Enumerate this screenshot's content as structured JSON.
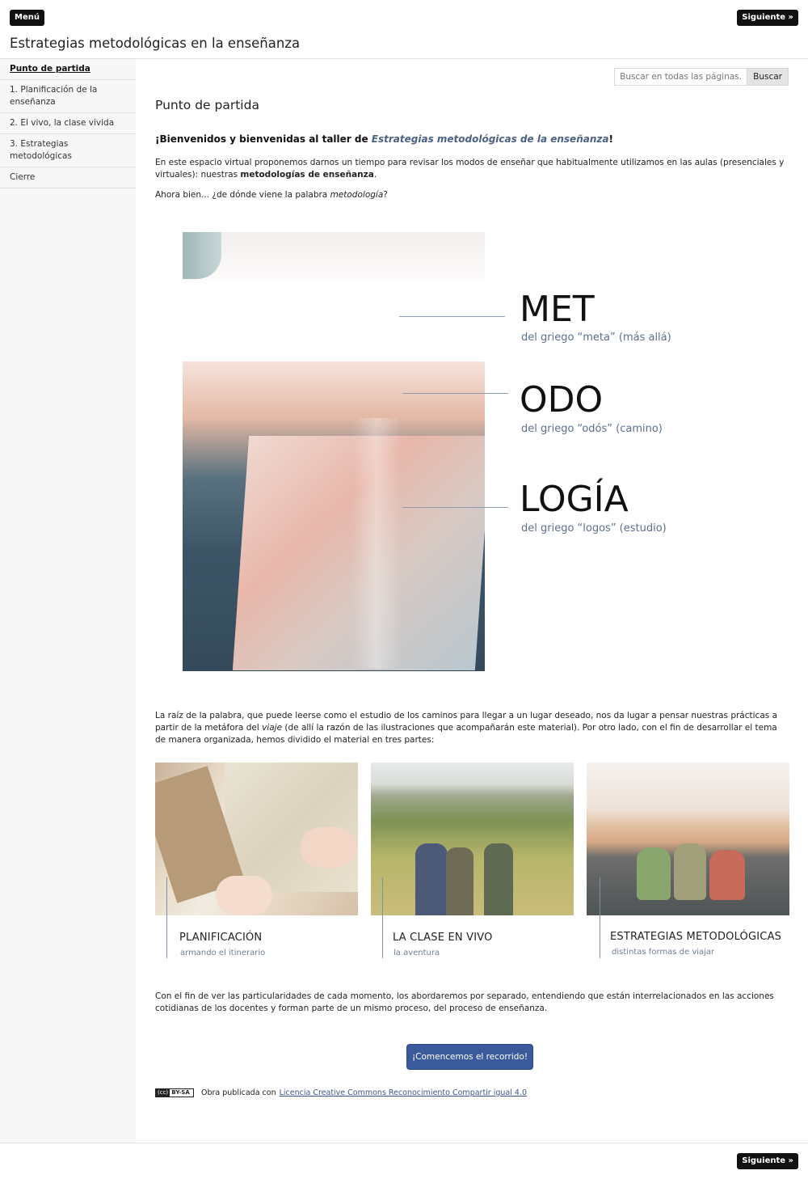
{
  "header": {
    "menu_label": "Menú",
    "next_label": "Siguiente »",
    "title": "Estrategias metodológicas en la enseñanza"
  },
  "sidebar": {
    "items": [
      {
        "label": "Punto de partida",
        "active": true
      },
      {
        "label": "1. Planificación de la enseñanza"
      },
      {
        "label": "2. El vivo, la clase vivida"
      },
      {
        "label": "3. Estrategias metodológicas"
      },
      {
        "label": "Cierre"
      }
    ]
  },
  "search": {
    "placeholder": "Buscar en todas las páginas..",
    "button_label": "Buscar"
  },
  "main": {
    "page_title": "Punto de partida",
    "welcome_prefix": "¡Bienvenidos y bienvenidas al taller de ",
    "welcome_highlight": "Estrategias metodológicas de la enseñanza",
    "welcome_suffix": "!",
    "intro_a": "En este espacio virtual proponemos darnos un tiempo para revisar los modos de enseñar que habitualmente utilizamos en las aulas (presenciales y virtuales): nuestras ",
    "intro_bold": "metodologías de enseñanza",
    "intro_b": ".",
    "question_a": "Ahora bien... ¿de dónde viene la palabra ",
    "question_em": "metodología",
    "question_b": "?",
    "hero_words": [
      {
        "word": "MET",
        "sub": "del griego “meta” (más allá)"
      },
      {
        "word": "ODO",
        "sub": "del griego “odós” (camino)"
      },
      {
        "word": "LOGÍA",
        "sub": "del griego “logos” (estudio)"
      }
    ],
    "root_a": "La raíz de la palabra, que puede leerse como el estudio de los caminos para llegar a un lugar deseado, nos da lugar a pensar nuestras prácticas a partir de la metáfora del ",
    "root_em": "viaje",
    "root_b": " (de allí la razón de las ilustraciones que acompañarán este material). Por otro lado, con el fin de desarrollar el tema de manera organizada, hemos dividido el material en tres partes:",
    "gallery": [
      {
        "title": "PLANIFICACIÓN",
        "sub": "armando el itinerario"
      },
      {
        "title": "LA CLASE EN VIVO",
        "sub": "la aventura"
      },
      {
        "title": "ESTRATEGIAS METODOLÓGICAS",
        "sub": "distintas formas de viajar"
      }
    ],
    "closing": "Con el fin de ver las particularidades de cada momento, los abordaremos por separado, entendiendo que están interrelacionados en las acciones cotidianas de los docentes y forman parte de un mismo proceso, del proceso de enseñanza.",
    "cta_label": "¡Comencemos el recorrido!",
    "license_badge": "BY-SA",
    "license_text": "Obra publicada con",
    "license_link": "Licencia Creative Commons Reconocimiento Compartir igual 4.0"
  },
  "colors": {
    "accent": "#3b5a9b",
    "highlight": "#4a6185",
    "subtitle": "#5c6f90"
  }
}
